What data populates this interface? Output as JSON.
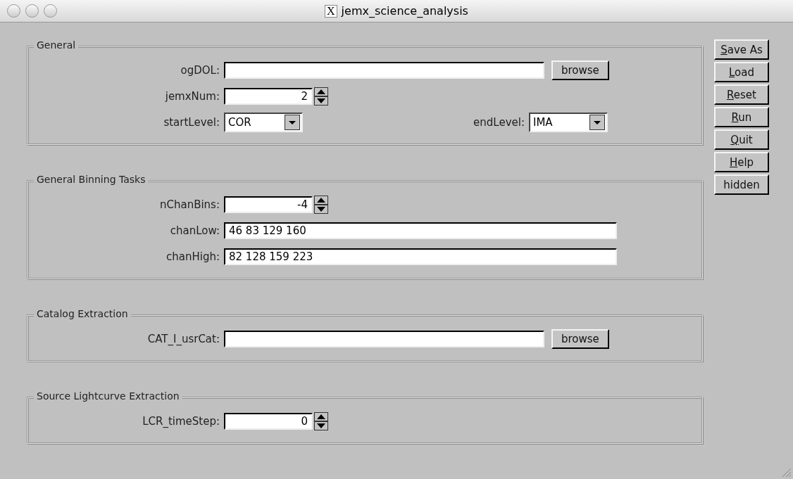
{
  "window": {
    "title": "jemx_science_analysis",
    "icon": "X"
  },
  "sections": [
    {
      "title": "General",
      "rows": [
        [
          {
            "kind": "file",
            "label": "ogDOL:",
            "button": "browse"
          }
        ],
        [
          {
            "kind": "spinner",
            "label": "jemxNum:",
            "value": "2"
          }
        ],
        [
          {
            "kind": "dropdown",
            "label": "startLevel:",
            "value": "COR"
          },
          {
            "kind": "dropdown",
            "label": "endLevel:",
            "value": "IMA"
          }
        ]
      ]
    },
    {
      "title": "General Binning Tasks",
      "rows": [
        [
          {
            "kind": "spinner",
            "label": "nChanBins:",
            "value": "-4"
          }
        ],
        [
          {
            "kind": "text",
            "label": "chanLow:",
            "value": "46 83 129 160"
          }
        ],
        [
          {
            "kind": "text",
            "label": "chanHigh:",
            "value": "82 128 159 223"
          }
        ]
      ]
    },
    {
      "title": "Catalog Extraction",
      "rows": [
        [
          {
            "kind": "file",
            "label": "CAT_I_usrCat:",
            "button": "browse"
          }
        ]
      ]
    },
    {
      "title": "Source Lightcurve Extraction",
      "rows": [
        [
          {
            "kind": "spinner",
            "label": "LCR_timeStep:",
            "value": "0"
          }
        ]
      ]
    }
  ],
  "buttons": [
    {
      "key": "S",
      "rest": "ave As"
    },
    {
      "key": "L",
      "rest": "oad"
    },
    {
      "key": "R",
      "rest": "eset"
    },
    {
      "key": "R",
      "rest": "un"
    },
    {
      "key": "Q",
      "rest": "uit"
    },
    {
      "key": "H",
      "rest": "elp"
    },
    {
      "rest": "hidden"
    }
  ]
}
